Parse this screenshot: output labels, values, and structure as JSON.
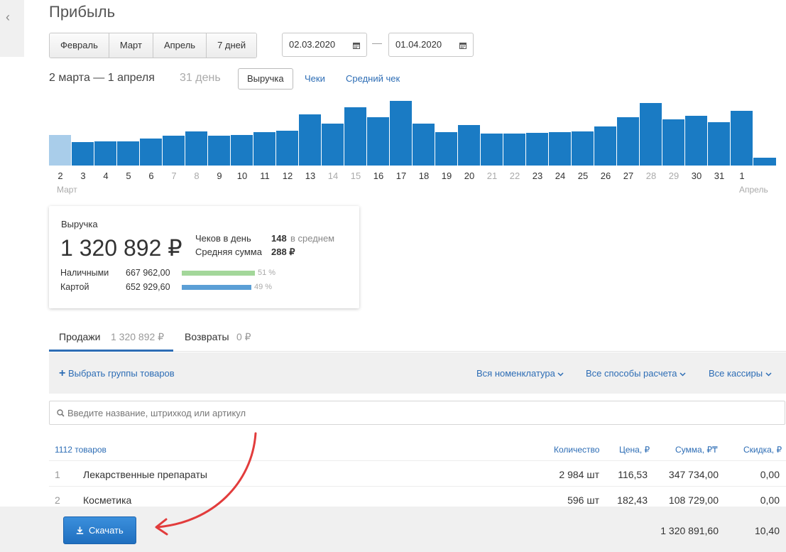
{
  "page": {
    "title": "Прибыль"
  },
  "period_buttons": [
    "Февраль",
    "Март",
    "Апрель",
    "7 дней"
  ],
  "date_range": {
    "from": "02.03.2020",
    "to": "01.04.2020",
    "separator": "—"
  },
  "range_label": "2 марта — 1 апреля",
  "days_label": "31 день",
  "metric_tabs": {
    "active": "Выручка",
    "links": [
      "Чеки",
      "Средний чек"
    ]
  },
  "chart_data": {
    "type": "bar",
    "categories": [
      "2",
      "3",
      "4",
      "5",
      "6",
      "7",
      "8",
      "9",
      "10",
      "11",
      "12",
      "13",
      "14",
      "15",
      "16",
      "17",
      "18",
      "19",
      "20",
      "21",
      "22",
      "23",
      "24",
      "25",
      "26",
      "27",
      "28",
      "29",
      "30",
      "31",
      "1"
    ],
    "values": [
      43,
      33,
      34,
      34,
      38,
      42,
      48,
      42,
      43,
      47,
      49,
      72,
      59,
      82,
      68,
      91,
      59,
      47,
      57,
      45,
      45,
      46,
      47,
      48,
      55,
      68,
      88,
      65,
      70,
      61,
      77,
      11
    ],
    "weekend_labels": [
      "7",
      "8",
      "14",
      "15",
      "21",
      "22",
      "28",
      "29"
    ],
    "month_labels": {
      "start": "Март",
      "end": "Апрель"
    },
    "colors": {
      "bar": "#1a7bc4",
      "bar_first": "#a9cdea",
      "tick": "#333333",
      "weekend_tick": "#aaaaaa"
    }
  },
  "summary": {
    "label": "Выручка",
    "total": "1 320 892 ₽",
    "checks_per_day_label": "Чеков в день",
    "checks_per_day_value": "148",
    "checks_per_day_suffix": "в среднем",
    "avg_sum_label": "Средняя сумма",
    "avg_sum_value": "288 ₽",
    "payments": [
      {
        "label": "Наличными",
        "amount": "667 962,00",
        "percent": "51 %",
        "share": 0.51,
        "color": "#a3d79a"
      },
      {
        "label": "Картой",
        "amount": "652 929,60",
        "percent": "49 %",
        "share": 0.49,
        "color": "#5b9fd6"
      }
    ]
  },
  "tabs": [
    {
      "label": "Продажи",
      "value": "1 320 892 ₽"
    },
    {
      "label": "Возвраты",
      "value": "0 ₽"
    }
  ],
  "filters": {
    "add_groups": "Выбрать группы товаров",
    "nomenclature": "Вся номенклатура",
    "payment": "Все способы расчета",
    "cashiers": "Все кассиры"
  },
  "search": {
    "placeholder": "Введите название, штрихкод или артикул"
  },
  "table": {
    "count_label": "1112 товаров",
    "columns": {
      "qty": "Количество",
      "price": "Цена, ₽",
      "sum": "Сумма, ₽₸",
      "discount": "Скидка, ₽"
    },
    "rows": [
      {
        "n": "1",
        "name": "Лекарственные препараты",
        "qty": "2 984 шт",
        "price": "116,53",
        "sum": "347 734,00",
        "discount": "0,00"
      },
      {
        "n": "2",
        "name": "Косметика",
        "qty": "596 шт",
        "price": "182,43",
        "sum": "108 729,00",
        "discount": "0,00"
      }
    ]
  },
  "footer": {
    "download_label": "Скачать",
    "total_sum": "1 320 891,60",
    "total_discount": "10,40"
  }
}
